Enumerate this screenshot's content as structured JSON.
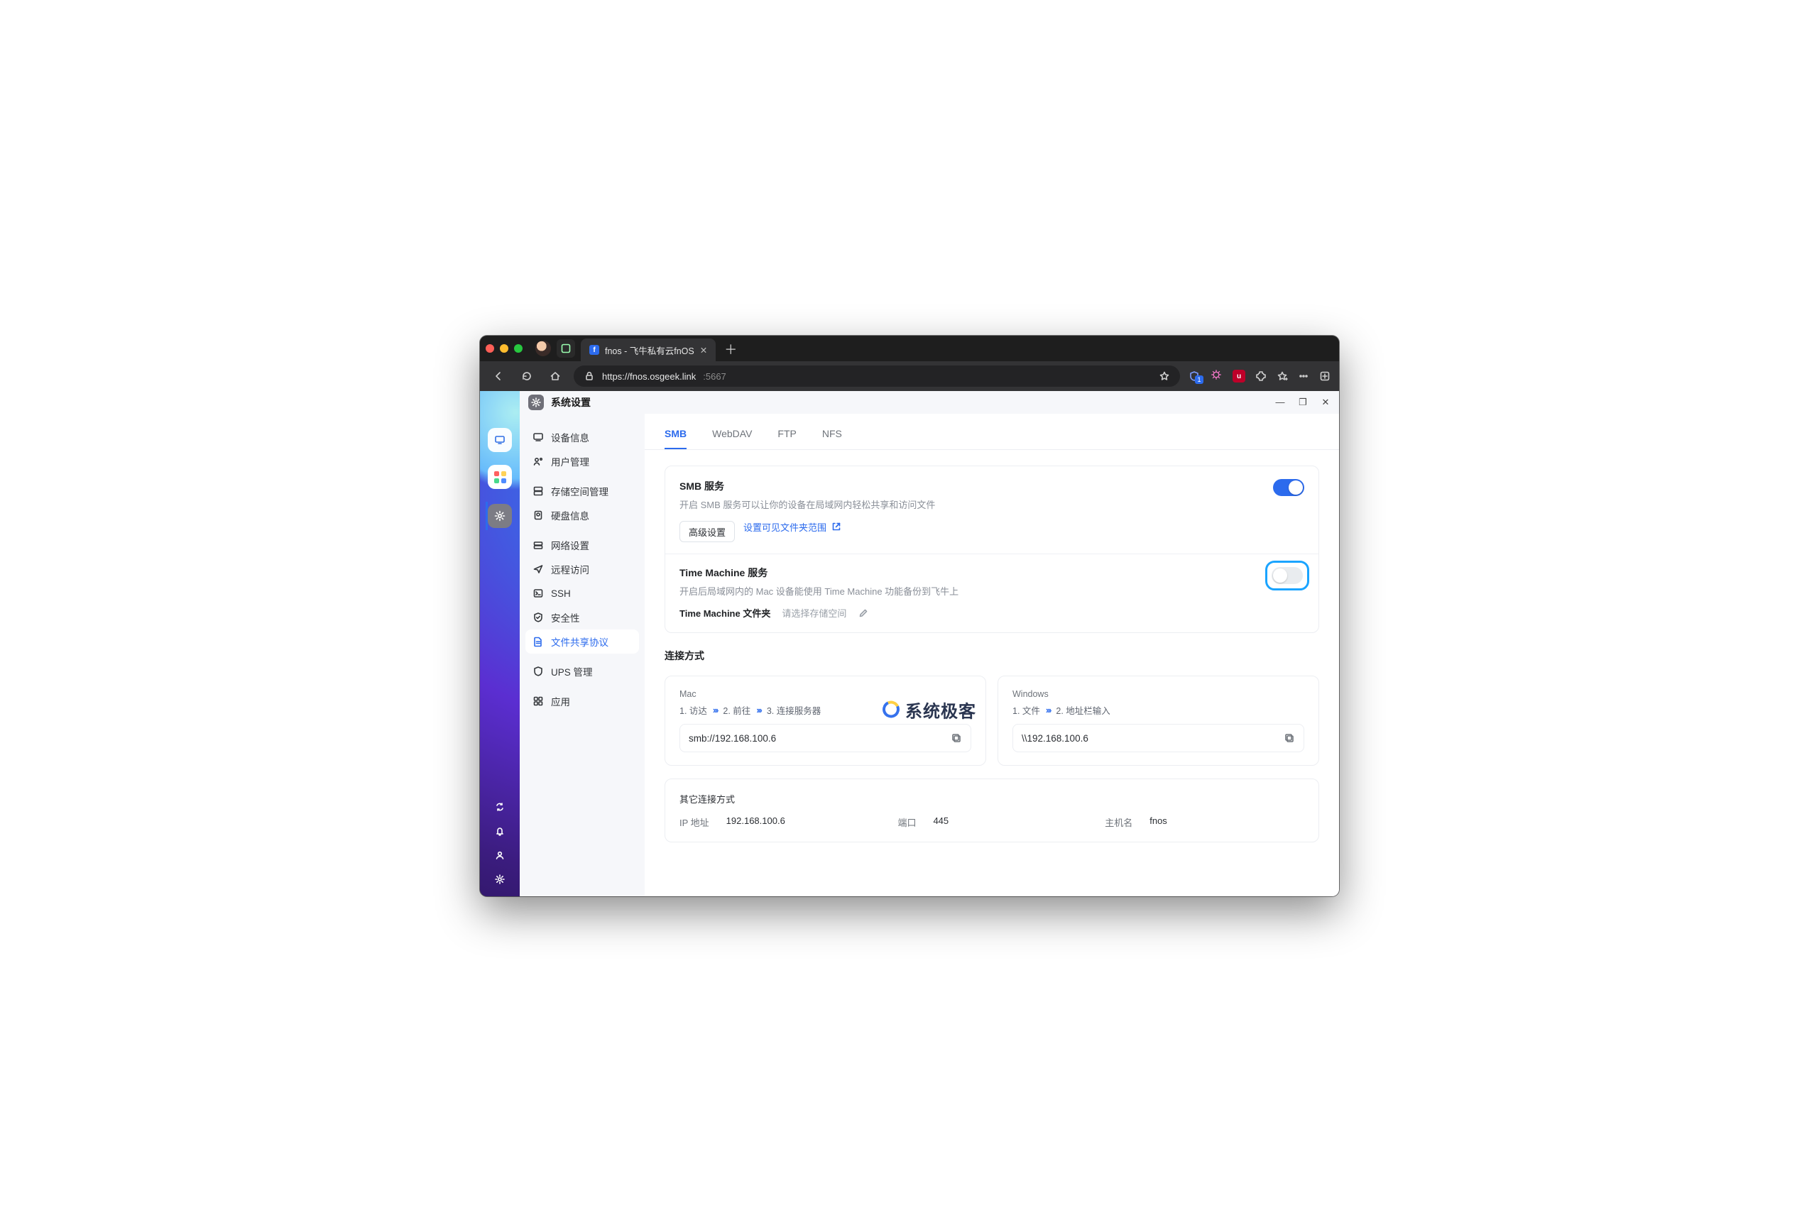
{
  "browser": {
    "tab_title": "fnos - 飞牛私有云fnOS",
    "url_host": "https://fnos.osgeek.link",
    "url_port": ":5667"
  },
  "app": {
    "title": "系统设置"
  },
  "sidebar": {
    "items": [
      {
        "label": "设备信息"
      },
      {
        "label": "用户管理"
      },
      {
        "label": "存储空间管理"
      },
      {
        "label": "硬盘信息"
      },
      {
        "label": "网络设置"
      },
      {
        "label": "远程访问"
      },
      {
        "label": "SSH"
      },
      {
        "label": "安全性"
      },
      {
        "label": "文件共享协议"
      },
      {
        "label": "UPS 管理"
      },
      {
        "label": "应用"
      }
    ]
  },
  "tabs": [
    {
      "label": "SMB"
    },
    {
      "label": "WebDAV"
    },
    {
      "label": "FTP"
    },
    {
      "label": "NFS"
    }
  ],
  "smb": {
    "title": "SMB 服务",
    "desc": "开启 SMB 服务可以让你的设备在局域网内轻松共享和访问文件",
    "advanced_btn": "高级设置",
    "visible_link": "设置可见文件夹范围"
  },
  "tm": {
    "title": "Time Machine 服务",
    "desc": "开启后局域网内的 Mac 设备能使用 Time Machine 功能备份到飞牛上",
    "folder_label": "Time Machine 文件夹",
    "folder_placeholder": "请选择存储空间"
  },
  "conn": {
    "section": "连接方式",
    "mac": {
      "title": "Mac",
      "step1": "1. 访达",
      "step2": "2. 前往",
      "step3": "3. 连接服务器",
      "addr": "smb://192.168.100.6"
    },
    "win": {
      "title": "Windows",
      "step1": "1. 文件",
      "step2": "2. 地址栏输入",
      "addr": "\\\\192.168.100.6"
    }
  },
  "other": {
    "title": "其它连接方式",
    "ip_k": "IP 地址",
    "ip_v": "192.168.100.6",
    "port_k": "端口",
    "port_v": "445",
    "host_k": "主机名",
    "host_v": "fnos"
  },
  "watermark": "系统极客"
}
